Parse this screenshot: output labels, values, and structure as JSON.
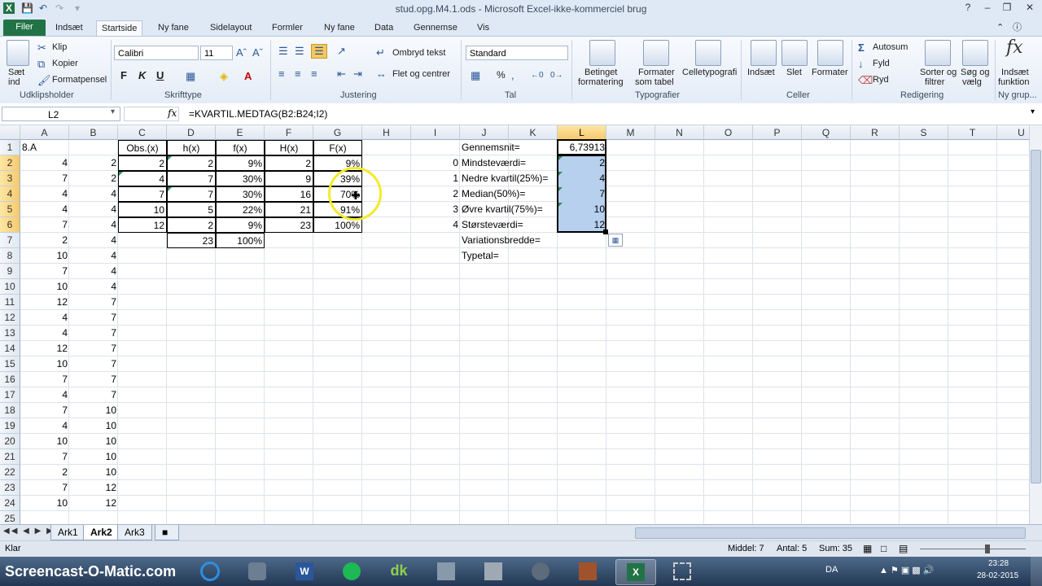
{
  "window": {
    "title": "stud.opg.M4.1.ods - Microsoft Excel-ikke-kommerciel brug"
  },
  "ribbon_tabs": [
    {
      "label": "Filer",
      "x": 0
    },
    {
      "label": "Indsæt",
      "x": 0
    },
    {
      "label": "Startside",
      "x": 0
    },
    {
      "label": "Ny fane",
      "x": 0
    },
    {
      "label": "Sidelayout",
      "x": 0
    },
    {
      "label": "Formler",
      "x": 0
    },
    {
      "label": "Ny fane",
      "x": 0
    },
    {
      "label": "Data",
      "x": 0
    },
    {
      "label": "Gennemse",
      "x": 0
    },
    {
      "label": "Vis",
      "x": 0
    }
  ],
  "ribbon": {
    "clipboard": {
      "paste_line1": "Sæt",
      "paste_line2": "ind",
      "cut": "Klip",
      "copy": "Kopier",
      "format_painter": "Formatpensel",
      "group": "Udklipsholder"
    },
    "font": {
      "name": "Calibri",
      "size": "11",
      "bold": "F",
      "italic": "K",
      "underline": "U",
      "group": "Skrifttype"
    },
    "alignment": {
      "wrap": "Ombryd tekst",
      "merge": "Flet og centrer",
      "group": "Justering"
    },
    "number": {
      "format": "Standard",
      "percent": "%",
      "group": "Tal"
    },
    "styles": {
      "cond_format_1": "Betinget",
      "cond_format_2": "formatering",
      "format_table_1": "Formater",
      "format_table_2": "som tabel",
      "cell_styles": "Celletypografi",
      "group": "Typografier"
    },
    "cells": {
      "insert": "Indsæt",
      "delete": "Slet",
      "format": "Formater",
      "group": "Celler"
    },
    "editing": {
      "autosum": "Autosum",
      "fill": "Fyld",
      "clear": "Ryd",
      "sort_1": "Sorter og",
      "sort_2": "filtrer",
      "find_1": "Søg og",
      "find_2": "vælg",
      "group": "Redigering"
    },
    "newgroup": {
      "insert_fn_1": "Indsæt",
      "insert_fn_2": "funktion",
      "group": "Ny grup..."
    }
  },
  "formula_bar": {
    "name_box": "L2",
    "fx": "fx",
    "formula": "=KVARTIL.MEDTAG(B2:B24;I2)"
  },
  "columns": [
    "A",
    "B",
    "C",
    "D",
    "E",
    "F",
    "G",
    "H",
    "I",
    "J",
    "K",
    "L",
    "M",
    "N",
    "O",
    "P",
    "Q",
    "R",
    "S",
    "T",
    "U"
  ],
  "rows": [
    "1",
    "2",
    "3",
    "4",
    "5",
    "6",
    "7",
    "8",
    "9",
    "10",
    "11",
    "12",
    "13",
    "14",
    "15",
    "16",
    "17",
    "18",
    "19",
    "20",
    "21",
    "22",
    "23",
    "24",
    "25"
  ],
  "cells": {
    "A": [
      "8.A",
      "4",
      "7",
      "4",
      "4",
      "7",
      "2",
      "10",
      "7",
      "10",
      "12",
      "4",
      "4",
      "12",
      "10",
      "7",
      "4",
      "7",
      "4",
      "10",
      "7",
      "2",
      "7",
      "10",
      ""
    ],
    "B": [
      "",
      "2",
      "2",
      "4",
      "4",
      "4",
      "4",
      "4",
      "4",
      "4",
      "7",
      "7",
      "7",
      "7",
      "7",
      "7",
      "7",
      "10",
      "10",
      "10",
      "10",
      "10",
      "12",
      "12",
      ""
    ],
    "C": [
      "Obs.(x)",
      "2",
      "4",
      "7",
      "10",
      "12"
    ],
    "D": [
      "h(x)",
      "2",
      "7",
      "7",
      "5",
      "2",
      "23"
    ],
    "E": [
      "f(x)",
      "9%",
      "30%",
      "30%",
      "22%",
      "9%",
      "100%"
    ],
    "F": [
      "H(x)",
      "2",
      "9",
      "16",
      "21",
      "23"
    ],
    "G": [
      "F(x)",
      "9%",
      "39%",
      "70%",
      "91%",
      "100%"
    ],
    "I": [
      "",
      "0",
      "1",
      "2",
      "3",
      "4"
    ],
    "J": [
      "Gennemsnit=",
      "Mindsteværdi=",
      "Nedre kvartil(25%)=",
      "Median(50%)=",
      "Øvre kvartil(75%)=",
      "Størsteværdi=",
      "Variationsbredde=",
      "Typetal="
    ],
    "L": [
      "6,73913",
      "2",
      "4",
      "7",
      "10",
      "12"
    ]
  },
  "sheets": [
    "Ark1",
    "Ark2",
    "Ark3"
  ],
  "active_sheet": "Ark2",
  "status": {
    "ready": "Klar",
    "average": "Middel: 7",
    "count": "Antal: 5",
    "sum": "Sum: 35"
  },
  "taskbar": {
    "watermark": "Screencast-O-Matic.com",
    "lang": "DA",
    "time": "23:28",
    "date": "28-02-2015"
  },
  "colors": {
    "excel_green": "#217346",
    "selection": "#b6d0ee",
    "header_selected": "#f7c96c",
    "highlight": "#f3ea2a"
  }
}
